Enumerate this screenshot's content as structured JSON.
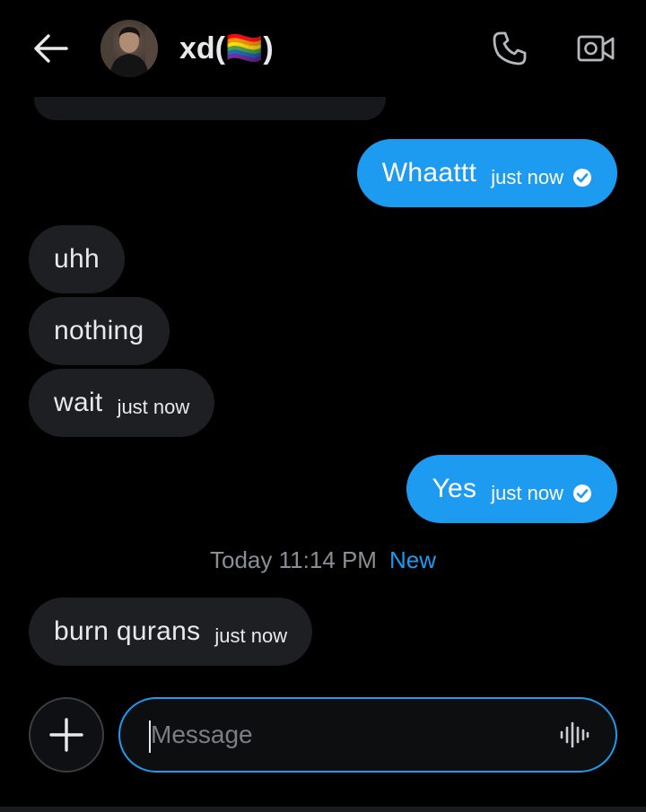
{
  "header": {
    "back_icon": "arrow-left-icon",
    "contact_name": "xd(🏳️‍🌈)",
    "call_icon": "phone-icon",
    "video_icon": "video-camera-icon"
  },
  "messages": [
    {
      "direction": "out",
      "text": "Whaattt",
      "time": "just now",
      "read": true
    },
    {
      "direction": "in",
      "text": "uhh"
    },
    {
      "direction": "in",
      "text": "nothing"
    },
    {
      "direction": "in",
      "text": "wait",
      "time": "just now"
    },
    {
      "direction": "out",
      "text": "Yes",
      "time": "just now",
      "read": true
    },
    {
      "direction": "in",
      "text": "burn qurans",
      "time": "just now"
    }
  ],
  "divider": {
    "timestamp": "Today 11:14 PM",
    "new_label": "New"
  },
  "composer": {
    "add_icon": "plus-icon",
    "placeholder": "Message",
    "voice_icon": "audio-waveform-icon"
  },
  "colors": {
    "background": "#000000",
    "accent": "#1d9bf0",
    "incoming_bubble": "#1d1f23",
    "text": "#e7e9ea",
    "muted": "#8b8f94"
  }
}
